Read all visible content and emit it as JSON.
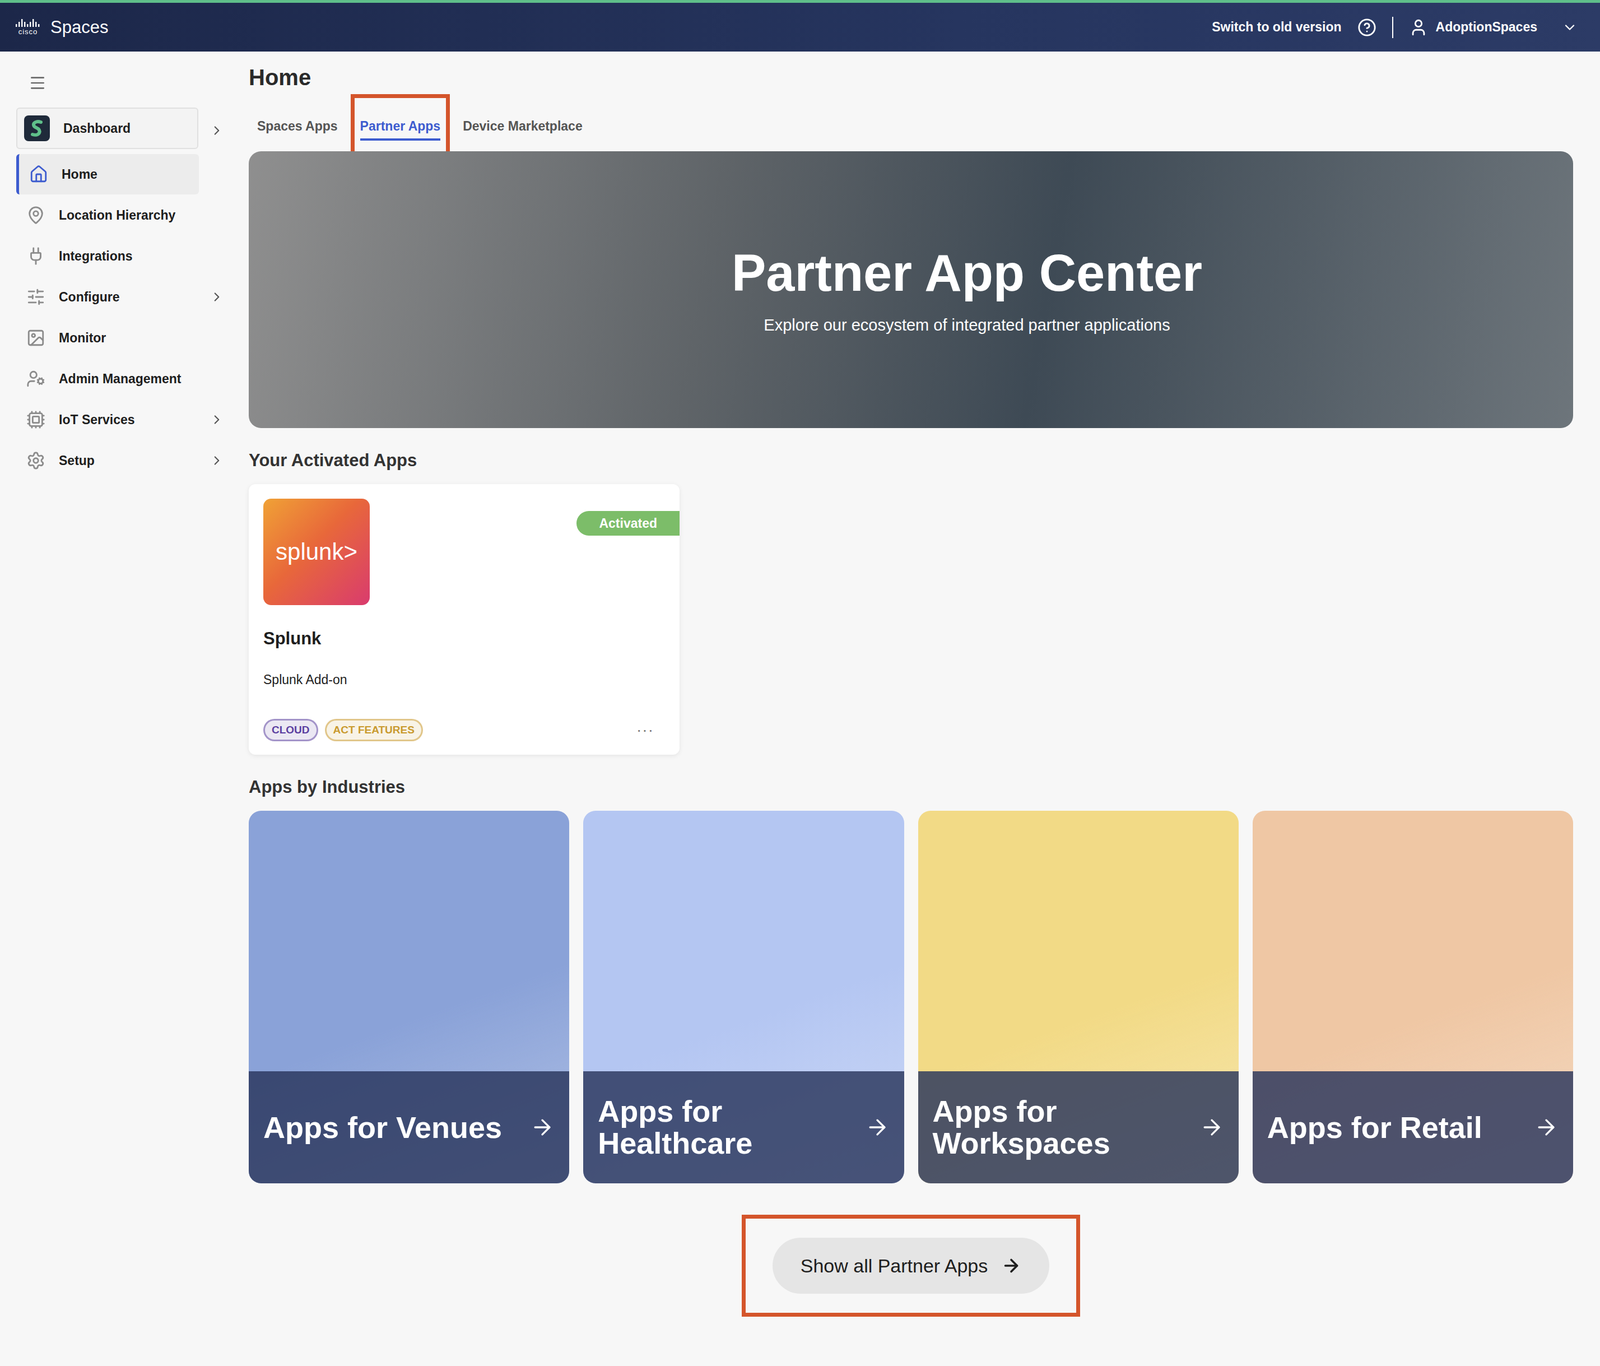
{
  "topbar": {
    "logo": "cisco",
    "brand": "Spaces",
    "switch_link": "Switch to old version",
    "user": "AdoptionSpaces"
  },
  "sidebar": {
    "items": [
      {
        "label": "Dashboard",
        "kind": "app",
        "selected": false,
        "has_submenu": true
      },
      {
        "label": "Home",
        "kind": "link",
        "selected": true,
        "has_submenu": false
      },
      {
        "label": "Location Hierarchy",
        "kind": "link",
        "selected": false,
        "has_submenu": false
      },
      {
        "label": "Integrations",
        "kind": "link",
        "selected": false,
        "has_submenu": false
      },
      {
        "label": "Configure",
        "kind": "link",
        "selected": false,
        "has_submenu": true
      },
      {
        "label": "Monitor",
        "kind": "link",
        "selected": false,
        "has_submenu": false
      },
      {
        "label": "Admin Management",
        "kind": "link",
        "selected": false,
        "has_submenu": false
      },
      {
        "label": "IoT Services",
        "kind": "link",
        "selected": false,
        "has_submenu": true
      },
      {
        "label": "Setup",
        "kind": "link",
        "selected": false,
        "has_submenu": true
      }
    ]
  },
  "page": {
    "title": "Home"
  },
  "tabs": [
    {
      "label": "Spaces Apps",
      "selected": false,
      "annotated": false
    },
    {
      "label": "Partner Apps",
      "selected": true,
      "annotated": true
    },
    {
      "label": "Device Marketplace",
      "selected": false,
      "annotated": false
    }
  ],
  "hero": {
    "title": "Partner App Center",
    "subtitle": "Explore our ecosystem of integrated partner applications"
  },
  "activated_apps": {
    "title": "Your Activated Apps",
    "apps": [
      {
        "name": "Splunk",
        "description": "Splunk Add-on",
        "logo_text": "splunk>",
        "status": "Activated",
        "menu": "···",
        "tags": [
          {
            "label": "CLOUD",
            "color": "#5b3fa0"
          },
          {
            "label": "ACT FEATURES",
            "color": "#c99a2e"
          }
        ]
      }
    ]
  },
  "industries": {
    "title": "Apps by Industries",
    "tiles": [
      {
        "label": "Apps for Venues",
        "color": "#8aa2d8"
      },
      {
        "label": "Apps for Healthcare",
        "color": "#b4c6f2"
      },
      {
        "label": "Apps for Workspaces",
        "color": "#f2da86"
      },
      {
        "label": "Apps for Retail",
        "color": "#efc7a4"
      }
    ]
  },
  "show_all_button": {
    "label": "Show all Partner Apps",
    "annotated": true
  }
}
